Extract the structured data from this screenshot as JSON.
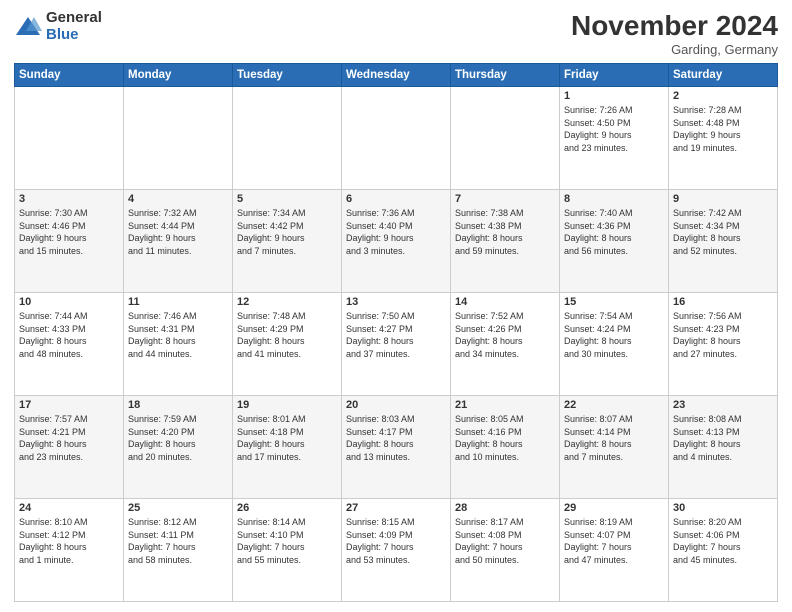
{
  "header": {
    "logo_general": "General",
    "logo_blue": "Blue",
    "month_title": "November 2024",
    "location": "Garding, Germany"
  },
  "days_of_week": [
    "Sunday",
    "Monday",
    "Tuesday",
    "Wednesday",
    "Thursday",
    "Friday",
    "Saturday"
  ],
  "weeks": [
    [
      {
        "day": "",
        "info": ""
      },
      {
        "day": "",
        "info": ""
      },
      {
        "day": "",
        "info": ""
      },
      {
        "day": "",
        "info": ""
      },
      {
        "day": "",
        "info": ""
      },
      {
        "day": "1",
        "info": "Sunrise: 7:26 AM\nSunset: 4:50 PM\nDaylight: 9 hours\nand 23 minutes."
      },
      {
        "day": "2",
        "info": "Sunrise: 7:28 AM\nSunset: 4:48 PM\nDaylight: 9 hours\nand 19 minutes."
      }
    ],
    [
      {
        "day": "3",
        "info": "Sunrise: 7:30 AM\nSunset: 4:46 PM\nDaylight: 9 hours\nand 15 minutes."
      },
      {
        "day": "4",
        "info": "Sunrise: 7:32 AM\nSunset: 4:44 PM\nDaylight: 9 hours\nand 11 minutes."
      },
      {
        "day": "5",
        "info": "Sunrise: 7:34 AM\nSunset: 4:42 PM\nDaylight: 9 hours\nand 7 minutes."
      },
      {
        "day": "6",
        "info": "Sunrise: 7:36 AM\nSunset: 4:40 PM\nDaylight: 9 hours\nand 3 minutes."
      },
      {
        "day": "7",
        "info": "Sunrise: 7:38 AM\nSunset: 4:38 PM\nDaylight: 8 hours\nand 59 minutes."
      },
      {
        "day": "8",
        "info": "Sunrise: 7:40 AM\nSunset: 4:36 PM\nDaylight: 8 hours\nand 56 minutes."
      },
      {
        "day": "9",
        "info": "Sunrise: 7:42 AM\nSunset: 4:34 PM\nDaylight: 8 hours\nand 52 minutes."
      }
    ],
    [
      {
        "day": "10",
        "info": "Sunrise: 7:44 AM\nSunset: 4:33 PM\nDaylight: 8 hours\nand 48 minutes."
      },
      {
        "day": "11",
        "info": "Sunrise: 7:46 AM\nSunset: 4:31 PM\nDaylight: 8 hours\nand 44 minutes."
      },
      {
        "day": "12",
        "info": "Sunrise: 7:48 AM\nSunset: 4:29 PM\nDaylight: 8 hours\nand 41 minutes."
      },
      {
        "day": "13",
        "info": "Sunrise: 7:50 AM\nSunset: 4:27 PM\nDaylight: 8 hours\nand 37 minutes."
      },
      {
        "day": "14",
        "info": "Sunrise: 7:52 AM\nSunset: 4:26 PM\nDaylight: 8 hours\nand 34 minutes."
      },
      {
        "day": "15",
        "info": "Sunrise: 7:54 AM\nSunset: 4:24 PM\nDaylight: 8 hours\nand 30 minutes."
      },
      {
        "day": "16",
        "info": "Sunrise: 7:56 AM\nSunset: 4:23 PM\nDaylight: 8 hours\nand 27 minutes."
      }
    ],
    [
      {
        "day": "17",
        "info": "Sunrise: 7:57 AM\nSunset: 4:21 PM\nDaylight: 8 hours\nand 23 minutes."
      },
      {
        "day": "18",
        "info": "Sunrise: 7:59 AM\nSunset: 4:20 PM\nDaylight: 8 hours\nand 20 minutes."
      },
      {
        "day": "19",
        "info": "Sunrise: 8:01 AM\nSunset: 4:18 PM\nDaylight: 8 hours\nand 17 minutes."
      },
      {
        "day": "20",
        "info": "Sunrise: 8:03 AM\nSunset: 4:17 PM\nDaylight: 8 hours\nand 13 minutes."
      },
      {
        "day": "21",
        "info": "Sunrise: 8:05 AM\nSunset: 4:16 PM\nDaylight: 8 hours\nand 10 minutes."
      },
      {
        "day": "22",
        "info": "Sunrise: 8:07 AM\nSunset: 4:14 PM\nDaylight: 8 hours\nand 7 minutes."
      },
      {
        "day": "23",
        "info": "Sunrise: 8:08 AM\nSunset: 4:13 PM\nDaylight: 8 hours\nand 4 minutes."
      }
    ],
    [
      {
        "day": "24",
        "info": "Sunrise: 8:10 AM\nSunset: 4:12 PM\nDaylight: 8 hours\nand 1 minute."
      },
      {
        "day": "25",
        "info": "Sunrise: 8:12 AM\nSunset: 4:11 PM\nDaylight: 7 hours\nand 58 minutes."
      },
      {
        "day": "26",
        "info": "Sunrise: 8:14 AM\nSunset: 4:10 PM\nDaylight: 7 hours\nand 55 minutes."
      },
      {
        "day": "27",
        "info": "Sunrise: 8:15 AM\nSunset: 4:09 PM\nDaylight: 7 hours\nand 53 minutes."
      },
      {
        "day": "28",
        "info": "Sunrise: 8:17 AM\nSunset: 4:08 PM\nDaylight: 7 hours\nand 50 minutes."
      },
      {
        "day": "29",
        "info": "Sunrise: 8:19 AM\nSunset: 4:07 PM\nDaylight: 7 hours\nand 47 minutes."
      },
      {
        "day": "30",
        "info": "Sunrise: 8:20 AM\nSunset: 4:06 PM\nDaylight: 7 hours\nand 45 minutes."
      }
    ]
  ]
}
